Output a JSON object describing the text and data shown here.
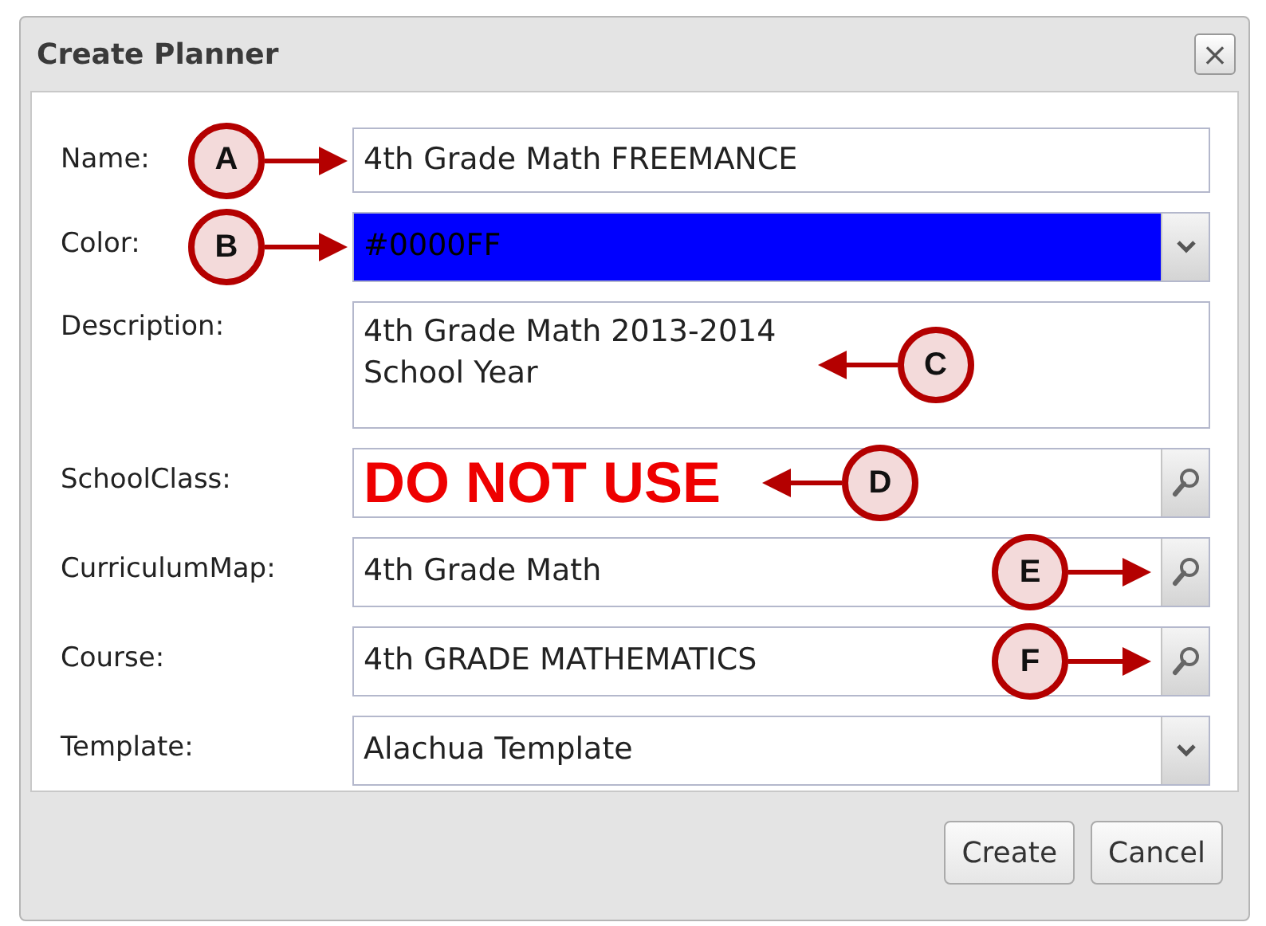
{
  "window": {
    "title": "Create Planner",
    "close": "×"
  },
  "fields": [
    {
      "kind": "text",
      "label": "Name:",
      "value": "4th Grade Math FREEMANCE",
      "callout": {
        "letter": "A",
        "kind": "label"
      }
    },
    {
      "kind": "color",
      "label": "Color:",
      "value": "#0000FF",
      "color": "#0000ff",
      "callout": {
        "letter": "B",
        "kind": "label"
      }
    },
    {
      "kind": "textarea",
      "label": "Description:",
      "value": "4th Grade Math 2013-2014\nSchool Year",
      "callout": {
        "letter": "C",
        "kind": "value"
      }
    },
    {
      "kind": "lookup",
      "label": "SchoolClass:",
      "note": "DO NOT USE",
      "callout": {
        "letter": "D",
        "kind": "value"
      }
    },
    {
      "kind": "lookup",
      "label": "CurriculumMap:",
      "value": "4th Grade Math",
      "callout": {
        "letter": "E",
        "kind": "button"
      }
    },
    {
      "kind": "lookup",
      "label": "Course:",
      "value": "4th GRADE MATHEMATICS",
      "callout": {
        "letter": "F",
        "kind": "button"
      }
    },
    {
      "kind": "select",
      "label": "Template:",
      "value": "Alachua Template"
    }
  ],
  "buttons": [
    "Create",
    "Cancel"
  ]
}
